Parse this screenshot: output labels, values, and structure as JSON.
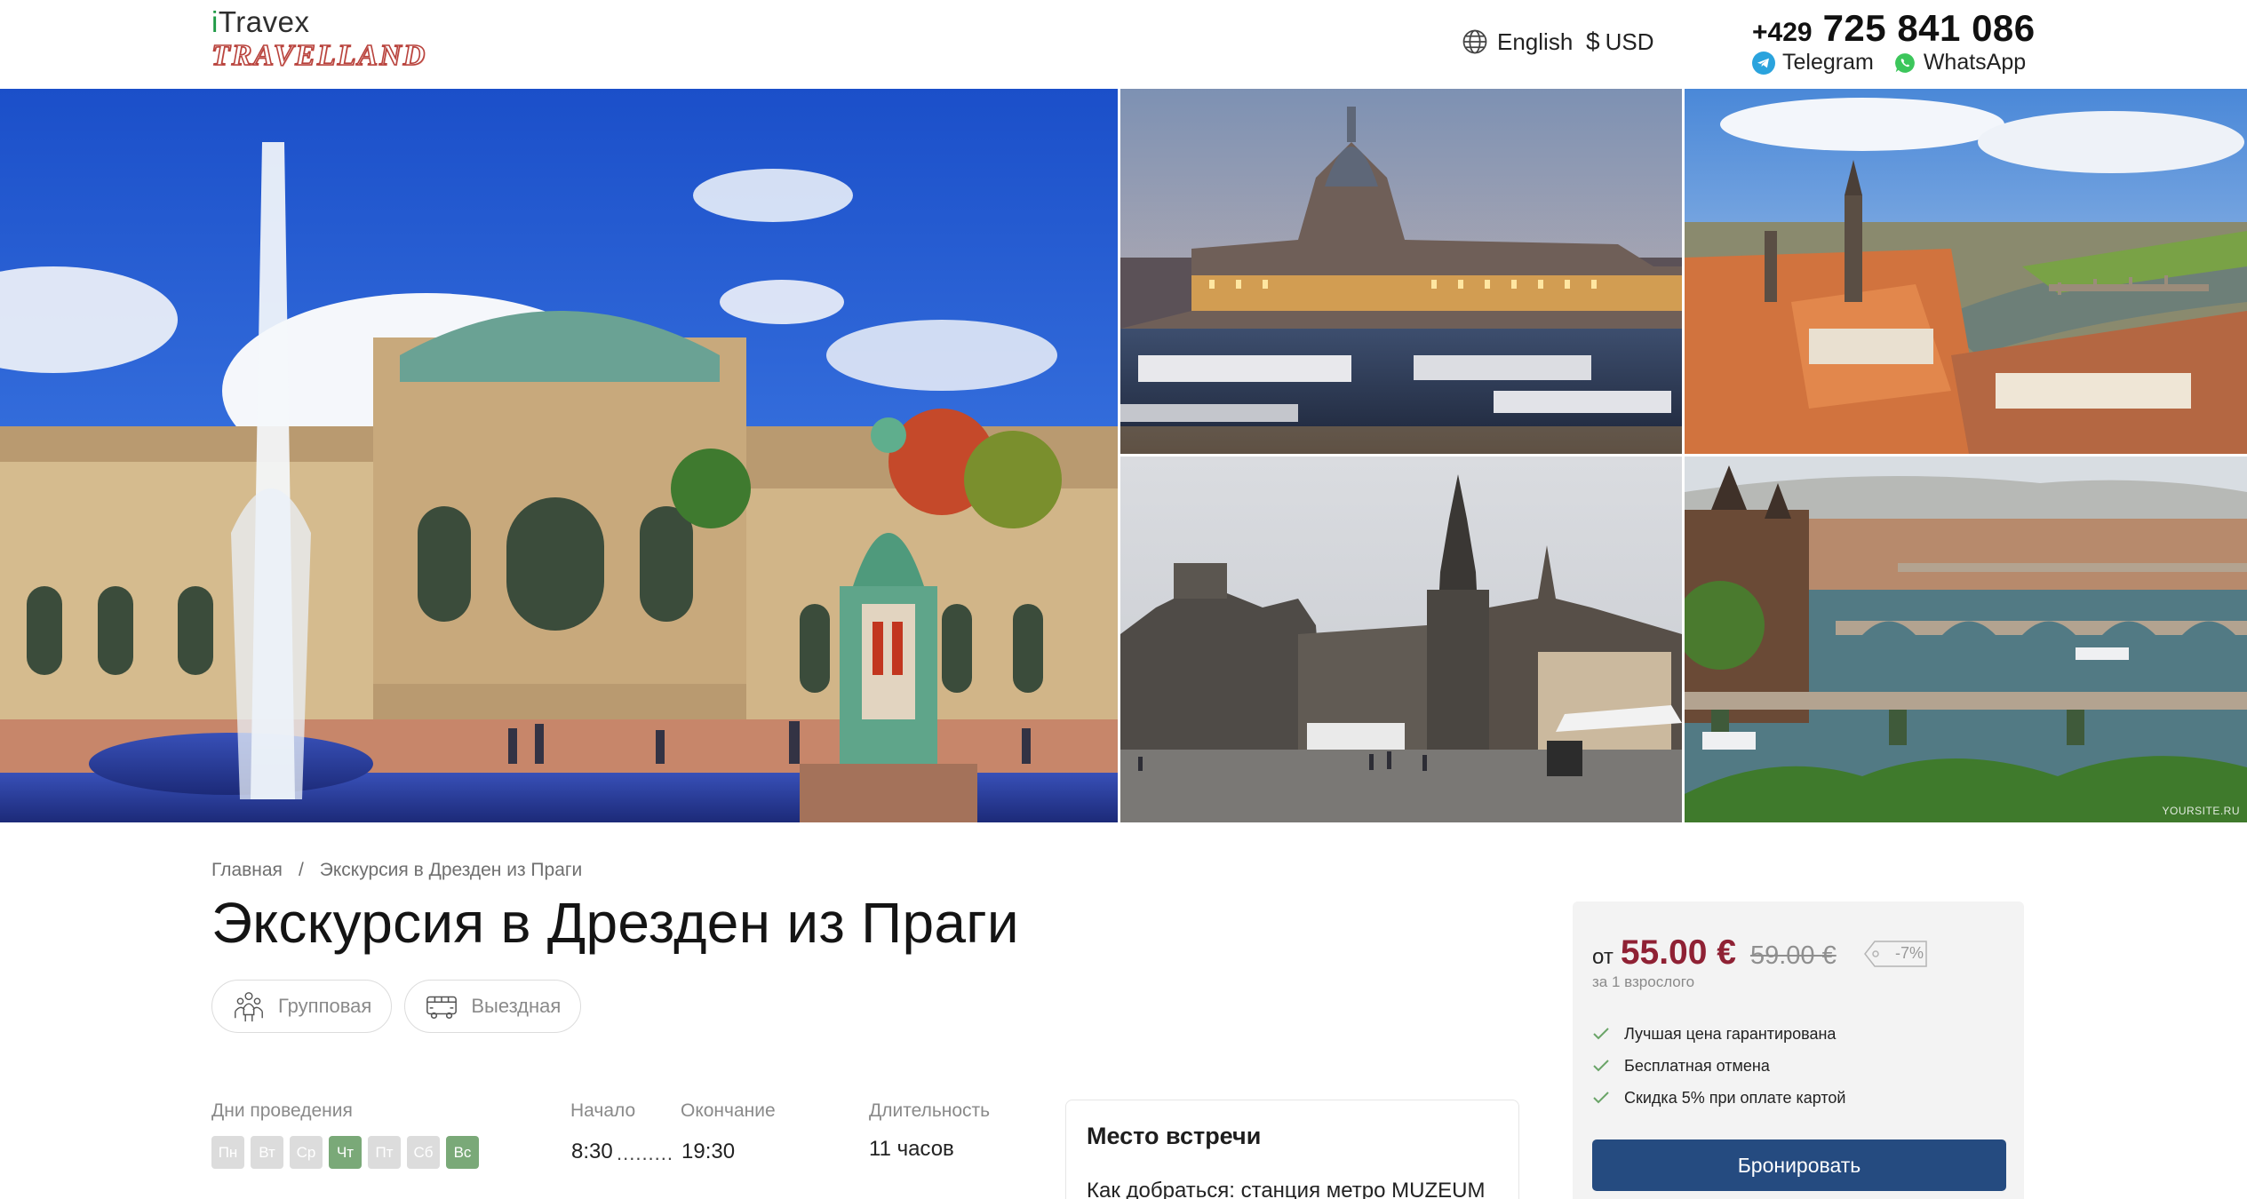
{
  "header": {
    "logo_top_prefix": "i",
    "logo_top_rest": "Travex",
    "logo_bottom": "TRAVELLAND",
    "language": "English",
    "currency_symbol": "$",
    "currency": "USD",
    "phone_code": "+429",
    "phone_number": "725 841 086",
    "telegram": "Telegram",
    "whatsapp": "WhatsApp"
  },
  "gallery": {
    "watermark": "YOURSITE.RU",
    "photos": [
      "zwinger-palace",
      "frauenkirche-evening",
      "dresden-aerial",
      "dresden-cathedral",
      "prague-bridges"
    ]
  },
  "breadcrumb": {
    "home": "Главная",
    "separator": "/",
    "current": "Экскурсия в Дрезден из Праги"
  },
  "tour": {
    "title": "Экскурсия в Дрезден из Праги",
    "tags": [
      {
        "label": "Групповая",
        "icon": "group-icon"
      },
      {
        "label": "Выездная",
        "icon": "bus-icon"
      }
    ],
    "days_label": "Дни проведения",
    "days": [
      {
        "label": "Пн",
        "active": false
      },
      {
        "label": "Вт",
        "active": false
      },
      {
        "label": "Ср",
        "active": false
      },
      {
        "label": "Чт",
        "active": true
      },
      {
        "label": "Пт",
        "active": false
      },
      {
        "label": "Сб",
        "active": false
      },
      {
        "label": "Вс",
        "active": true
      }
    ],
    "start_label": "Начало",
    "start_time": "8:30",
    "end_label": "Окончание",
    "end_time": "19:30",
    "dots": ".........",
    "duration_label": "Длительность",
    "duration": "11 часов"
  },
  "meeting": {
    "title": "Место встречи",
    "text": "Как добраться: станция метро MUZEUM"
  },
  "pricing": {
    "from": "от",
    "price": "55.00 €",
    "old_price": "59.00 €",
    "discount": "-7%",
    "per": "за 1 взрослого",
    "benefits": [
      "Лучшая цена гарантирована",
      "Бесплатная отмена",
      "Скидка 5% при оплате картой"
    ],
    "book_label": "Бронировать"
  },
  "colors": {
    "accent_button": "#254b80",
    "price": "#8f2134",
    "day_active": "#7aa978",
    "day_inactive": "#dcdcdc",
    "check": "#6aa468"
  }
}
